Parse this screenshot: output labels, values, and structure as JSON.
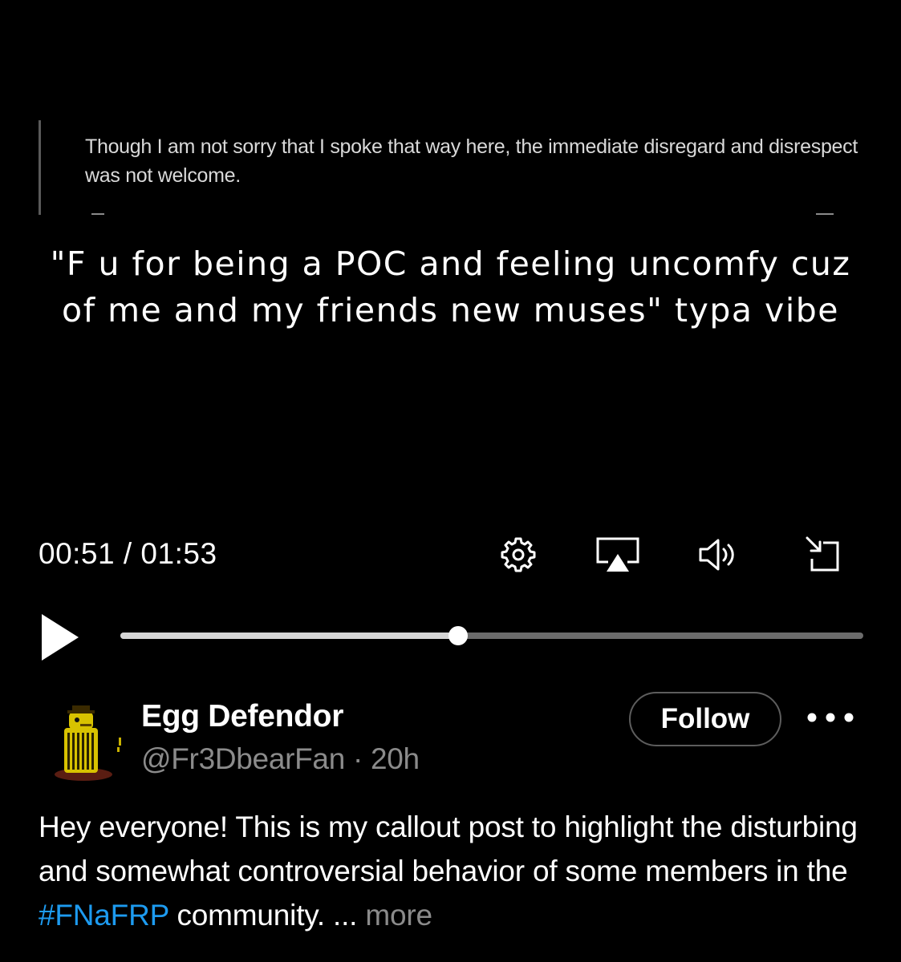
{
  "video": {
    "quote_text": "Though I am not sorry that I spoke that way here, the immediate disregard and disrespect was not welcome.",
    "caption": "\"F u for being a POC and feeling uncomfy cuz of me and my friends new muses\" typa vibe",
    "time": "00:51 / 01:53",
    "progress_fraction": 0.455,
    "icons": [
      "settings-icon",
      "airplay-icon",
      "volume-icon",
      "minimize-icon",
      "play-icon"
    ]
  },
  "post": {
    "author_name": "Egg Defendor",
    "handle": "@Fr3DbearFan",
    "separator": " · ",
    "time_ago": "20h",
    "follow_label": "Follow",
    "text_before": "Hey everyone! This is my callout post to highlight the disturbing and somewhat controversial behavior of some members in the ",
    "hashtag": "#FNaFRP",
    "text_after": " community. ",
    "ellipsis": "...",
    "more_label": "more"
  },
  "colors": {
    "background": "#000000",
    "text": "#ffffff",
    "muted": "#8b8b8b",
    "hashtag": "#1d9bf0",
    "track": "#6c6c6c",
    "track_fill": "#d6d6d6"
  }
}
